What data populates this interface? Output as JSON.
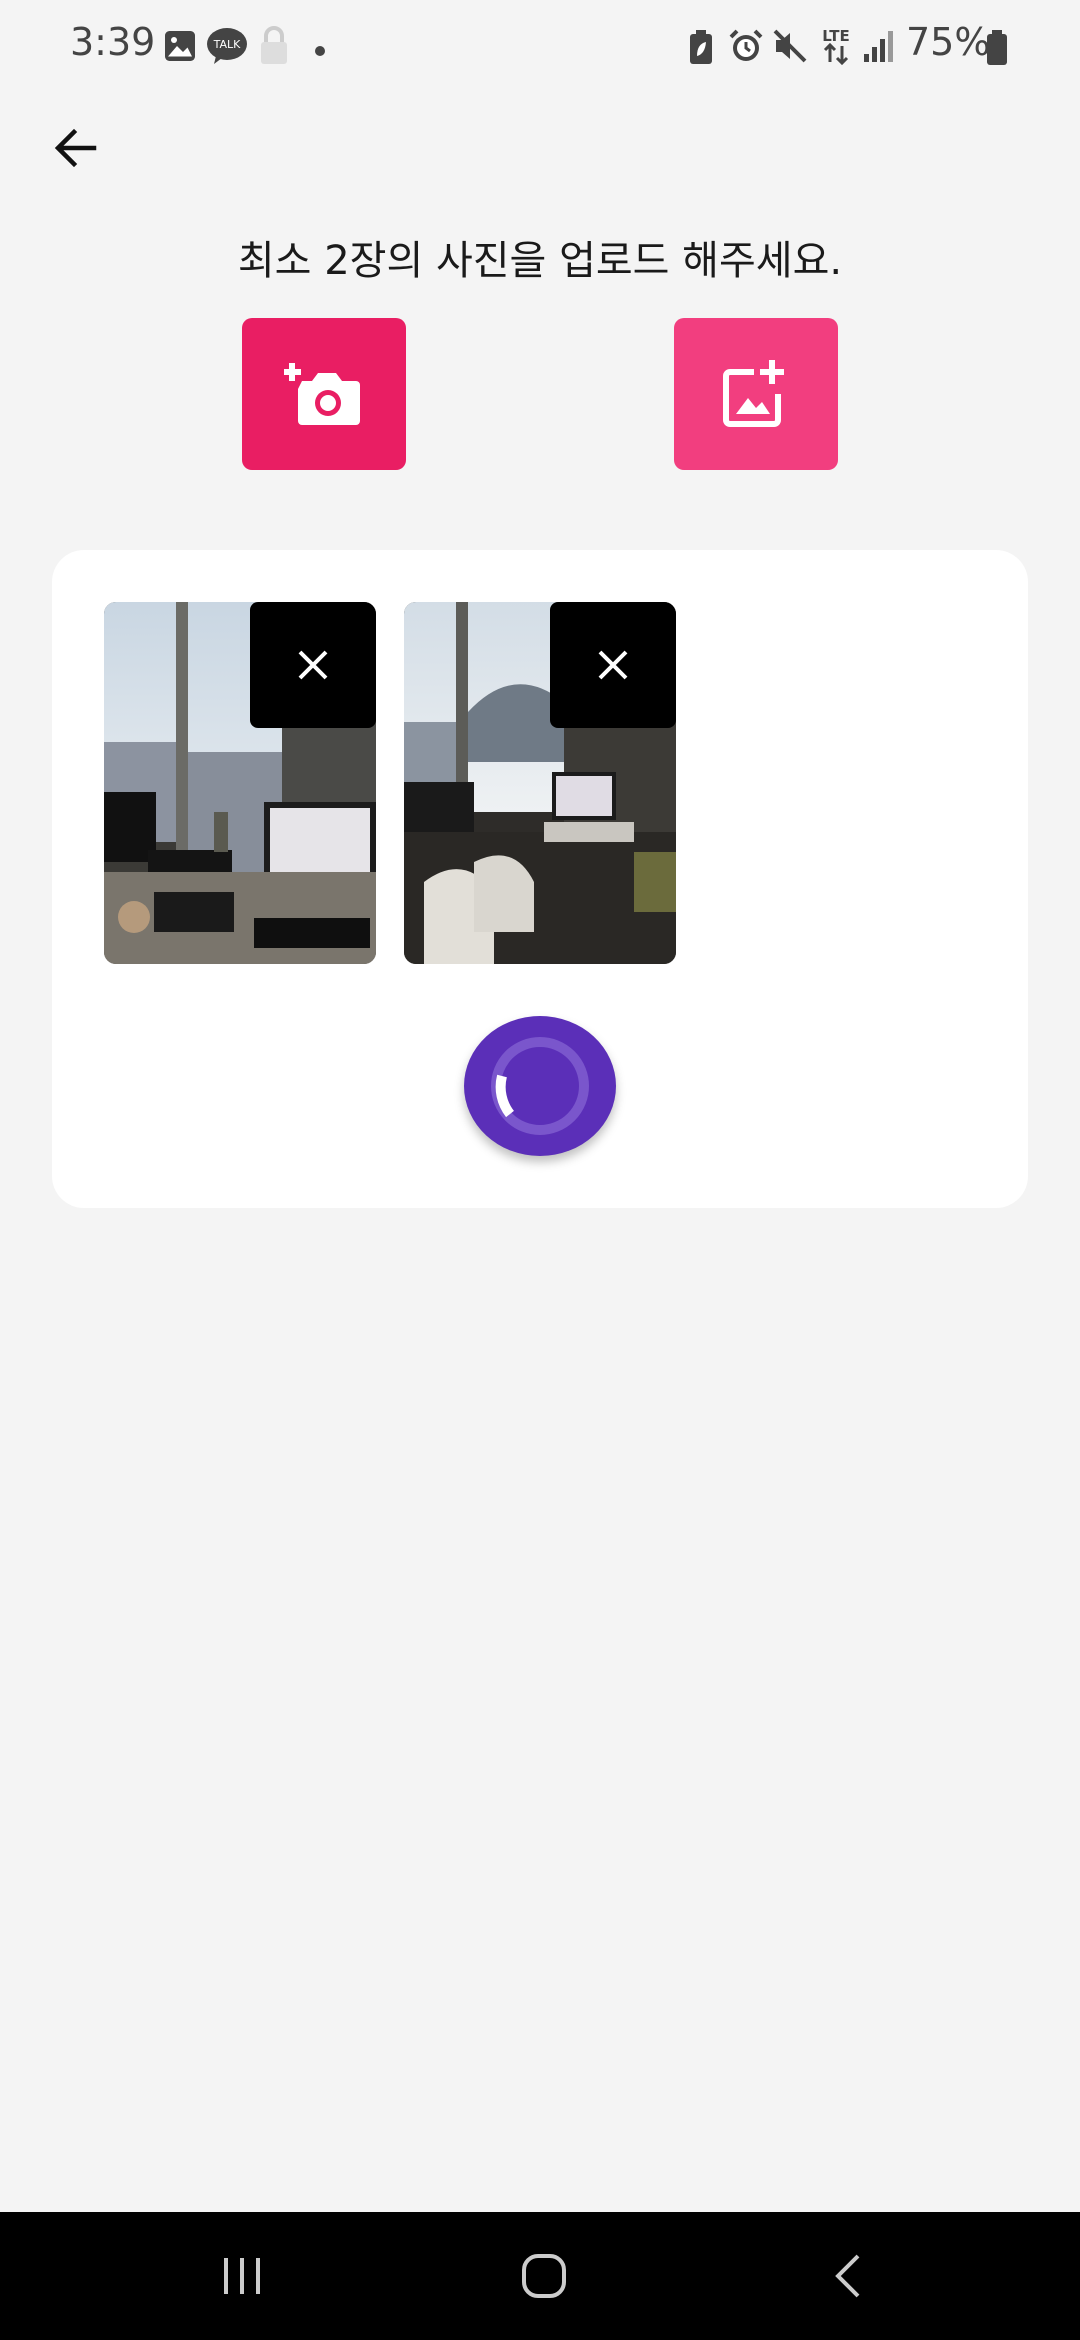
{
  "status_bar": {
    "time": "3:39",
    "battery_percent": "75%",
    "icons": [
      "gallery-notification-icon",
      "kakaotalk-icon",
      "lock-icon",
      "dot-icon",
      "battery-saver-icon",
      "alarm-icon",
      "mute-icon",
      "lte-icon",
      "signal-icon",
      "battery-icon"
    ],
    "kakaotalk_text": "TALK",
    "lte_text": "LTE"
  },
  "header": {
    "back_icon": "arrow-left-icon"
  },
  "instruction": "최소 2장의 사진을 업로드 해주세요.",
  "actions": {
    "camera_icon": "add-camera-icon",
    "gallery_icon": "add-photo-icon",
    "camera_color": "#e91e63",
    "gallery_color": "#f23e7f"
  },
  "photos": [
    {
      "remove_icon": "close-icon"
    },
    {
      "remove_icon": "close-icon"
    }
  ],
  "loader": {
    "color": "#5b2fb8"
  },
  "nav_bar": {
    "recent_icon": "recent-apps-icon",
    "home_icon": "home-icon",
    "back_icon": "back-chevron-icon"
  }
}
